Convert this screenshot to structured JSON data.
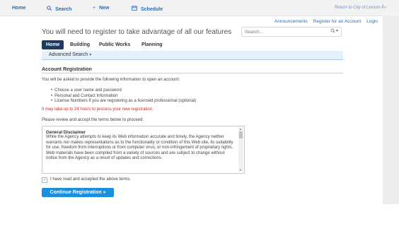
{
  "topnav": {
    "home": "Home",
    "search": "Search",
    "new": "New",
    "schedule": "Schedule",
    "return_link": "Return to City of Lincoln Â»"
  },
  "header": {
    "announcements": "Announcements",
    "register": "Register for an Account",
    "login": "Login",
    "register_message": "You will need to register to take advantage of all our features",
    "search_placeholder": "Search..."
  },
  "tabs": [
    {
      "label": "Home",
      "active": true
    },
    {
      "label": "Building",
      "active": false
    },
    {
      "label": "Public Works",
      "active": false
    },
    {
      "label": "Planning",
      "active": false
    }
  ],
  "advanced_search": "Advanced Search",
  "section": {
    "title": "Account Registration",
    "intro": "You will be asked to provide the following information to open an account:",
    "bullets": [
      "Choose a user name and password",
      "Personal and Contact Information",
      "License Numbers if you are registering as a licensed professional (optional)"
    ],
    "warning": "It may take up to 24 hours to process your new registration.",
    "review": "Please review and accept the terms below to proceed."
  },
  "disclaimer": {
    "title": "General Disclaimer",
    "body": "While the Agency attempts to keep its Web information accurate and timely, the Agency neither warrants nor makes representations as to the functionality or condition of this Web site, its suitability for use, freedom from interruptions or from computer virus, or non-infringement of proprietary rights. Web materials have been compiled from a variety of sources and are subject to change without notice from the Agency as a result of updates and corrections."
  },
  "accept_label": "I have read and accepted the above terms.",
  "continue_button": "Continue Registration »",
  "colors": {
    "brand_navy": "#1d3a63",
    "link_blue": "#2a6bb5",
    "button_blue": "#1a8fe0",
    "warning_red": "#e02424"
  },
  "icons": {
    "search": "search-icon",
    "new": "plus-icon",
    "schedule": "calendar-icon"
  }
}
